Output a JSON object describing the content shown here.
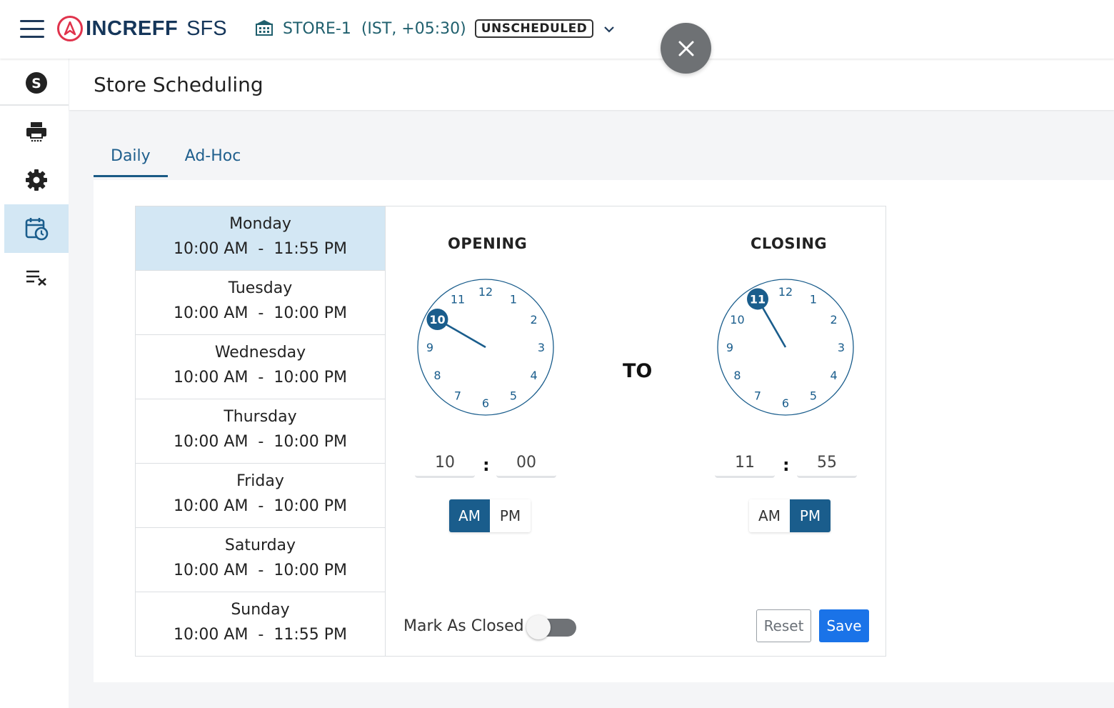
{
  "header": {
    "logo_text": "INCREFF",
    "logo_sub": "SFS",
    "store_name": "STORE-1",
    "store_timezone": "(IST, +05:30)",
    "status_badge": "UNSCHEDULED"
  },
  "sidebar": {
    "items": [
      {
        "icon": "s-badge-icon"
      },
      {
        "icon": "printer-icon"
      },
      {
        "icon": "gear-icon"
      },
      {
        "icon": "calendar-clock-icon",
        "active": true
      },
      {
        "icon": "clear-list-icon"
      }
    ]
  },
  "page": {
    "title": "Store Scheduling"
  },
  "tabs": [
    {
      "label": "Daily",
      "active": true
    },
    {
      "label": "Ad-Hoc",
      "active": false
    }
  ],
  "days": [
    {
      "name": "Monday",
      "time": "10:00 AM  -  11:55 PM",
      "active": true
    },
    {
      "name": "Tuesday",
      "time": "10:00 AM  -  10:00 PM"
    },
    {
      "name": "Wednesday",
      "time": "10:00 AM  -  10:00 PM"
    },
    {
      "name": "Thursday",
      "time": "10:00 AM  -  10:00 PM"
    },
    {
      "name": "Friday",
      "time": "10:00 AM  -  10:00 PM"
    },
    {
      "name": "Saturday",
      "time": "10:00 AM  -  10:00 PM"
    },
    {
      "name": "Sunday",
      "time": "10:00 AM  -  11:55 PM"
    }
  ],
  "opening": {
    "label": "OPENING",
    "hour": "10",
    "minute": "00",
    "period": "AM",
    "selected_hour": 10
  },
  "closing": {
    "label": "CLOSING",
    "hour": "11",
    "minute": "55",
    "period": "PM",
    "selected_hour": 11
  },
  "to_label": "TO",
  "ampm": {
    "am": "AM",
    "pm": "PM"
  },
  "colon": ":",
  "mark_closed": {
    "label": "Mark As Closed",
    "value": false
  },
  "buttons": {
    "reset": "Reset",
    "save": "Save"
  },
  "colors": {
    "primary": "#1a5d8c",
    "save": "#1a73e8",
    "selected_row": "#d3e7f4"
  }
}
